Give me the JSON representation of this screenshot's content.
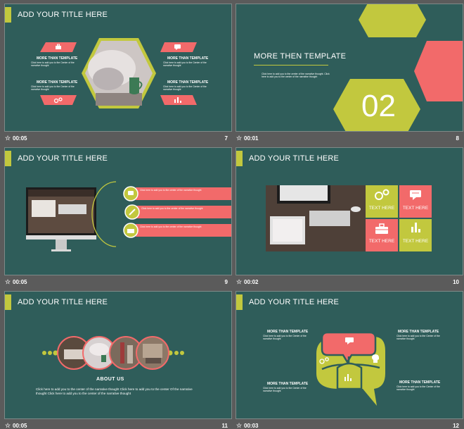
{
  "slides": [
    {
      "title": "ADD YOUR TITLE HERE",
      "time": "00:05",
      "number": "7",
      "blocks": [
        {
          "heading": "MORE THAN TEMPLATE",
          "body": "Click here to add you to the Center of the narrative thought"
        },
        {
          "heading": "MORE THAN TEMPLATE",
          "body": "Click here to add you to the Center of the narrative thought"
        },
        {
          "heading": "MORE THAN TEMPLATE",
          "body": "Click here to add you to the Center of the narrative thought"
        },
        {
          "heading": "MORE THAN TEMPLATE",
          "body": "Click here to add you to the Center of the narrative thought"
        }
      ]
    },
    {
      "title": "MORE THEN TEMPLATE",
      "time": "00:01",
      "number": "8",
      "body": "Click here to add you to the center of the narrative thought. Click here to add you to the center of the narrative thought",
      "big_number": "02"
    },
    {
      "title": "ADD YOUR TITLE HERE",
      "time": "00:05",
      "number": "9",
      "items": [
        "Click here to add you to the center of the narrative thought",
        "Click here to add you to the center of the narrative thought",
        "Click here to add you to the center of the narrative thought"
      ]
    },
    {
      "title": "ADD YOUR TITLE HERE",
      "time": "00:02",
      "number": "10",
      "tiles": [
        "TEXT HERE",
        "TEXT HERE",
        "TEXT HERE",
        "TEXT HERE"
      ]
    },
    {
      "title": "ADD YOUR TITLE HERE",
      "time": "00:05",
      "number": "11",
      "heading": "ABOUT US",
      "body": "Click here to add you to the center of the narrative thought Click here to add you to the center Of the narrative thought Click here to add you to the center of the narrative thought"
    },
    {
      "title": "ADD YOUR TITLE HERE",
      "time": "00:03",
      "number": "12",
      "blocks": [
        {
          "heading": "MORE THAN TEMPLATE",
          "body": "Click here to add you to the Center of the narrative thought"
        },
        {
          "heading": "MORE THAN TEMPLATE",
          "body": "Click here to add you to the Center of the narrative thought"
        },
        {
          "heading": "MORE THAN TEMPLATE",
          "body": "Click here to add you to the Center of the narrative thought"
        },
        {
          "heading": "MORE THAN TEMPLATE",
          "body": "Click here to add you to the Center of the narrative thought"
        }
      ]
    }
  ],
  "colors": {
    "background": "#2f5d5a",
    "accent_green": "#c2c83e",
    "accent_coral": "#f26a6a",
    "panel_gray": "#5b5b5b"
  },
  "icons": [
    "star-icon",
    "briefcase-icon",
    "chat-icon",
    "gears-icon",
    "pencil-icon",
    "bar-chart-icon",
    "idea-head-icon"
  ]
}
